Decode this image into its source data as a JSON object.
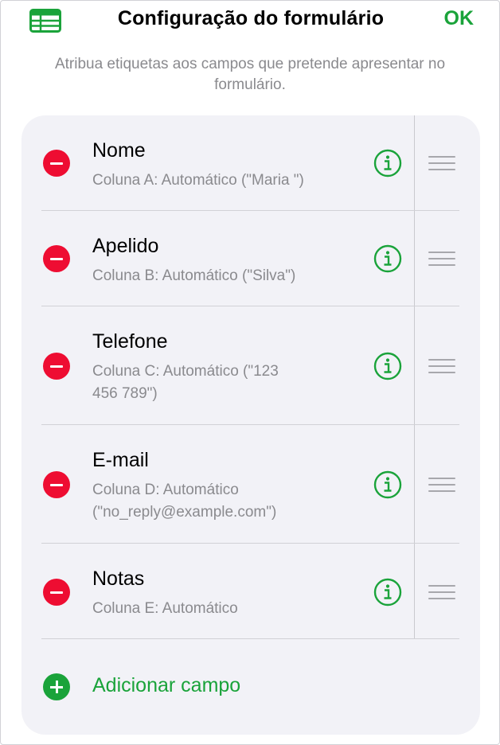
{
  "header": {
    "title": "Configuração do formulário",
    "ok_label": "OK",
    "table_icon": "table-icon"
  },
  "subtitle": "Atribua etiquetas aos campos que pretende apresentar no formulário.",
  "fields": [
    {
      "name": "Nome",
      "desc_line1": "Coluna A: Automático (\"Maria \")",
      "desc_line2": ""
    },
    {
      "name": "Apelido",
      "desc_line1": "Coluna B: Automático (\"Silva\")",
      "desc_line2": ""
    },
    {
      "name": "Telefone",
      "desc_line1": "Coluna C: Automático (\"123",
      "desc_line2": "456 789\")"
    },
    {
      "name": "E-mail",
      "desc_line1": "Coluna D: Automático",
      "desc_line2": "(\"no_reply@example.com\")"
    },
    {
      "name": "Notas",
      "desc_line1": "Coluna E: Automático",
      "desc_line2": ""
    }
  ],
  "add_field_label": "Adicionar campo",
  "colors": {
    "accent_green": "#1aa33a",
    "remove_red": "#ee0d32",
    "card_background": "#f2f2f7",
    "secondary_text": "#8a8a8e"
  },
  "icons": {
    "remove": "minus-circle-icon",
    "info": "info-circle-icon",
    "reorder": "reorder-grip-icon",
    "add": "plus-circle-icon"
  }
}
